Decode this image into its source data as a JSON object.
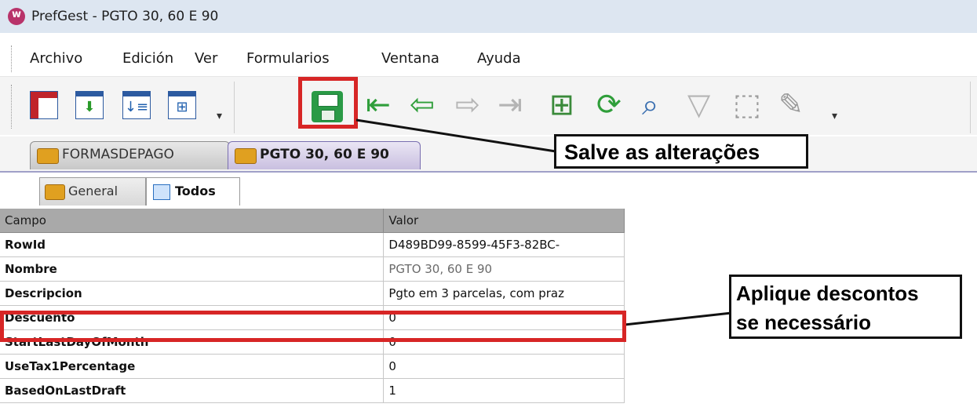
{
  "window": {
    "title": "PrefGest - PGTO 30, 60 E 90"
  },
  "menu": {
    "items": [
      "Archivo",
      "Edición",
      "Ver",
      "Formularios",
      "Ventana",
      "Ayuda"
    ]
  },
  "toolbar": {
    "buttons": [
      "form-layout-icon",
      "sort-down-icon",
      "sort-list-icon",
      "grid-view-icon",
      "save-icon",
      "first-record-icon",
      "previous-record-icon",
      "next-record-icon",
      "last-record-icon",
      "add-record-icon",
      "refresh-icon",
      "search-icon",
      "filter-icon",
      "select-icon",
      "edit-icon"
    ]
  },
  "tabs": [
    {
      "label": "FORMASDEPAGO",
      "active": false
    },
    {
      "label": "PGTO 30, 60 E 90",
      "active": true
    }
  ],
  "subtabs": [
    {
      "label": "General",
      "active": false
    },
    {
      "label": "Todos",
      "active": true
    }
  ],
  "grid": {
    "headers": [
      "Campo",
      "Valor"
    ],
    "rows": [
      {
        "field": "RowId",
        "value": "D489BD99-8599-45F3-82BC-"
      },
      {
        "field": "Nombre",
        "value": "PGTO 30, 60 E 90"
      },
      {
        "field": "Descripcion",
        "value": "Pgto em 3 parcelas, com praz"
      },
      {
        "field": "Descuento",
        "value": "0"
      },
      {
        "field": "StartLastDayOfMonth",
        "value": "0"
      },
      {
        "field": "UseTax1Percentage",
        "value": "0"
      },
      {
        "field": "BasedOnLastDraft",
        "value": "1"
      }
    ]
  },
  "annotations": {
    "save": "Salve as alterações",
    "discount_line1": "Aplique descontos",
    "discount_line2": "se necessário"
  },
  "colors": {
    "highlight": "#d72626",
    "save_green": "#2a9a46",
    "active_tab": "#c9bfe0"
  }
}
